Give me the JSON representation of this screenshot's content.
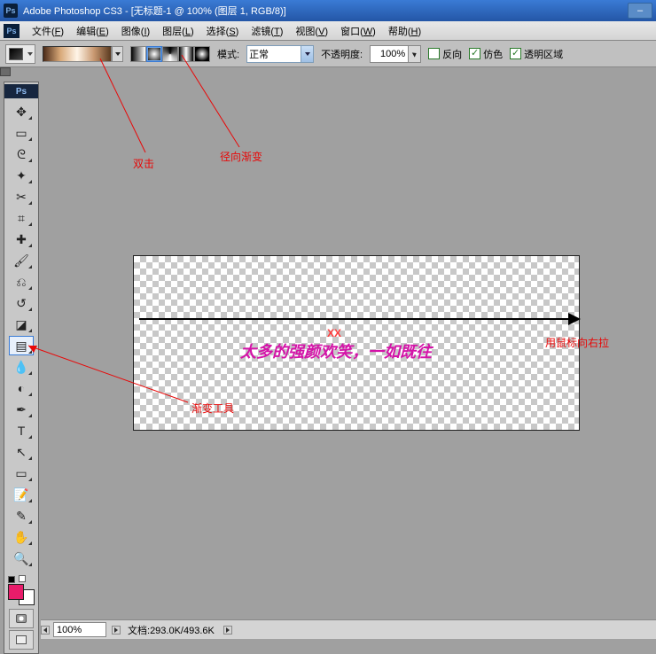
{
  "window": {
    "title": "Adobe Photoshop CS3 - [无标题-1 @ 100% (图层 1, RGB/8)]"
  },
  "menubar": {
    "items": [
      {
        "label": "文件",
        "accel": "F"
      },
      {
        "label": "编辑",
        "accel": "E"
      },
      {
        "label": "图像",
        "accel": "I"
      },
      {
        "label": "图层",
        "accel": "L"
      },
      {
        "label": "选择",
        "accel": "S"
      },
      {
        "label": "滤镜",
        "accel": "T"
      },
      {
        "label": "视图",
        "accel": "V"
      },
      {
        "label": "窗口",
        "accel": "W"
      },
      {
        "label": "帮助",
        "accel": "H"
      }
    ]
  },
  "options": {
    "mode_label": "模式:",
    "mode_value": "正常",
    "opacity_label": "不透明度:",
    "opacity_value": "100%",
    "reverse_label": "反向",
    "reverse_checked": false,
    "dither_label": "仿色",
    "dither_checked": true,
    "transparency_label": "透明区域",
    "transparency_checked": true
  },
  "tools": {
    "header": "Ps",
    "list": [
      {
        "name": "move-tool",
        "glyph": "✥"
      },
      {
        "name": "marquee-tool",
        "glyph": "▭"
      },
      {
        "name": "lasso-tool",
        "glyph": "ᘓ"
      },
      {
        "name": "wand-tool",
        "glyph": "✦"
      },
      {
        "name": "crop-tool",
        "glyph": "✂"
      },
      {
        "name": "slice-tool",
        "glyph": "⌗"
      },
      {
        "name": "healing-tool",
        "glyph": "✚"
      },
      {
        "name": "brush-tool",
        "glyph": "🖌"
      },
      {
        "name": "stamp-tool",
        "glyph": "⎌"
      },
      {
        "name": "history-brush-tool",
        "glyph": "↺"
      },
      {
        "name": "eraser-tool",
        "glyph": "◪"
      },
      {
        "name": "gradient-tool",
        "glyph": "▤",
        "selected": true
      },
      {
        "name": "blur-tool",
        "glyph": "💧"
      },
      {
        "name": "dodge-tool",
        "glyph": "◐"
      },
      {
        "name": "pen-tool",
        "glyph": "✒"
      },
      {
        "name": "type-tool",
        "glyph": "T"
      },
      {
        "name": "path-select-tool",
        "glyph": "↖"
      },
      {
        "name": "shape-tool",
        "glyph": "▭"
      },
      {
        "name": "notes-tool",
        "glyph": "📝"
      },
      {
        "name": "eyedropper-tool",
        "glyph": "✎"
      },
      {
        "name": "hand-tool",
        "glyph": "✋"
      },
      {
        "name": "zoom-tool",
        "glyph": "🔍"
      }
    ]
  },
  "canvas": {
    "watermark": "太多的强颜欢笑，一如既往",
    "xx": "XX"
  },
  "annotations": {
    "double_click": "双击",
    "radial_gradient": "径向渐变",
    "gradient_tool": "渐变工具",
    "drag_right": "用鼠标向右拉"
  },
  "status": {
    "zoom": "100%",
    "doc_label": "文档:",
    "doc_info": "293.0K/493.6K"
  },
  "colors": {
    "foreground": "#e81c6a",
    "background": "#ffffff"
  }
}
